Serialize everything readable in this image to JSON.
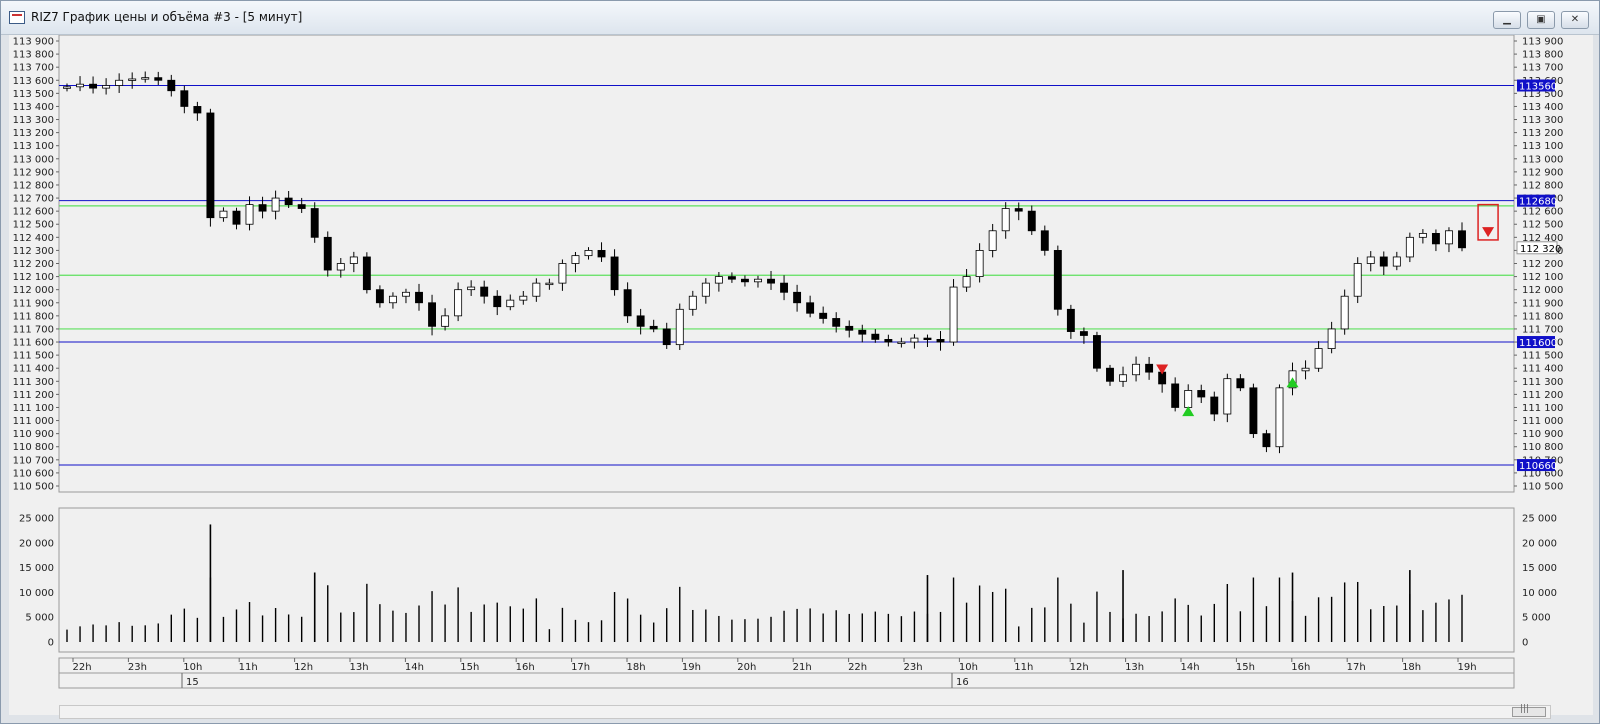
{
  "window": {
    "title": "RIZ7 График цены и объёма #3 - [5 минут]",
    "buttons": [
      "▁",
      "▣",
      "✕"
    ]
  },
  "chart_data": {
    "type": "candlestick",
    "price_axis": {
      "min": 110500,
      "max": 113900,
      "tick_step": 100,
      "tick_labels": [
        "113 900",
        "113 800",
        "113 700",
        "113 600",
        "113 500",
        "113 400",
        "113 300",
        "113 200",
        "113 100",
        "113 000",
        "112 900",
        "112 800",
        "112 700",
        "112 600",
        "112 500",
        "112 400",
        "112 300",
        "112 200",
        "112 100",
        "112 000",
        "111 900",
        "111 800",
        "111 700",
        "111 600",
        "111 500",
        "111 400",
        "111 300",
        "111 200",
        "111 100",
        "111 000",
        "110 900",
        "110 800",
        "110 700",
        "110 600",
        "110 500"
      ]
    },
    "volume_axis": {
      "min": 0,
      "max": 25000,
      "tick_labels": [
        "25 000",
        "20 000",
        "15 000",
        "10 000",
        "5 000",
        "0"
      ],
      "tick_values": [
        25000,
        20000,
        15000,
        10000,
        5000,
        0
      ]
    },
    "time_axis": {
      "hour_labels": [
        "22h",
        "23h",
        "10h",
        "11h",
        "12h",
        "13h",
        "14h",
        "15h",
        "16h",
        "17h",
        "18h",
        "19h",
        "20h",
        "21h",
        "22h",
        "23h",
        "10h",
        "11h",
        "12h",
        "13h",
        "14h",
        "15h",
        "16h",
        "17h",
        "18h",
        "19h"
      ],
      "date_labels": [
        "15",
        "16"
      ]
    },
    "blue_levels": [
      {
        "value": 113560,
        "label": "113560"
      },
      {
        "value": 112680,
        "label": "112680"
      },
      {
        "value": 111600,
        "label": "111600"
      },
      {
        "value": 110660,
        "label": "110660"
      }
    ],
    "green_levels": [
      112640,
      112110,
      111700
    ],
    "last_price": {
      "value": 112320,
      "label": "112 320"
    },
    "colors": {
      "level_blue": "#1010c8",
      "level_green": "#5ee05e",
      "candle": "#000000",
      "signal_buy": "#22cc22",
      "signal_sell": "#dd2222",
      "grid_border": "#9a9a9a"
    },
    "signals": [
      {
        "type": "sell",
        "time": "13:35",
        "price": 111390
      },
      {
        "type": "buy",
        "time": "14:05",
        "price": 111080
      },
      {
        "type": "buy",
        "time": "16:00",
        "price": 111300
      },
      {
        "type": "sell",
        "time": "19:10",
        "price": 112440
      }
    ],
    "close_series": [
      {
        "t": "21:25",
        "v": 113550
      },
      {
        "t": "21:40",
        "v": 113570
      },
      {
        "t": "21:55",
        "v": 113540
      },
      {
        "t": "22:10",
        "v": 113560
      },
      {
        "t": "22:25",
        "v": 113600
      },
      {
        "t": "22:40",
        "v": 113610
      },
      {
        "t": "22:55",
        "v": 113620
      },
      {
        "t": "23:10",
        "v": 113600
      },
      {
        "t": "23:25",
        "v": 113520
      },
      {
        "t": "23:40",
        "v": 113400
      },
      {
        "t": "23:50",
        "v": 113350
      },
      {
        "t": "10:00",
        "v": 112550
      },
      {
        "t": "10:15",
        "v": 112600
      },
      {
        "t": "10:30",
        "v": 112500
      },
      {
        "t": "10:45",
        "v": 112650
      },
      {
        "t": "11:00",
        "v": 112600
      },
      {
        "t": "11:15",
        "v": 112700
      },
      {
        "t": "11:30",
        "v": 112650
      },
      {
        "t": "11:45",
        "v": 112620
      },
      {
        "t": "12:00",
        "v": 112400
      },
      {
        "t": "12:15",
        "v": 112150
      },
      {
        "t": "12:30",
        "v": 112200
      },
      {
        "t": "12:45",
        "v": 112250
      },
      {
        "t": "13:00",
        "v": 112000
      },
      {
        "t": "13:15",
        "v": 111900
      },
      {
        "t": "13:30",
        "v": 111950
      },
      {
        "t": "13:45",
        "v": 111980
      },
      {
        "t": "14:00",
        "v": 111900
      },
      {
        "t": "14:10",
        "v": 111720
      },
      {
        "t": "14:25",
        "v": 111800
      },
      {
        "t": "14:40",
        "v": 112000
      },
      {
        "t": "14:55",
        "v": 112020
      },
      {
        "t": "15:10",
        "v": 111950
      },
      {
        "t": "15:25",
        "v": 111870
      },
      {
        "t": "15:40",
        "v": 111920
      },
      {
        "t": "15:55",
        "v": 111950
      },
      {
        "t": "16:10",
        "v": 112050
      },
      {
        "t": "16:25",
        "v": 112050
      },
      {
        "t": "16:40",
        "v": 112200
      },
      {
        "t": "16:55",
        "v": 112260
      },
      {
        "t": "17:10",
        "v": 112300
      },
      {
        "t": "17:25",
        "v": 112250
      },
      {
        "t": "17:35",
        "v": 112000
      },
      {
        "t": "17:50",
        "v": 111800
      },
      {
        "t": "18:05",
        "v": 111720
      },
      {
        "t": "18:20",
        "v": 111700
      },
      {
        "t": "18:30",
        "v": 111580
      },
      {
        "t": "18:45",
        "v": 111850
      },
      {
        "t": "19:00",
        "v": 111950
      },
      {
        "t": "19:15",
        "v": 112050
      },
      {
        "t": "19:30",
        "v": 112100
      },
      {
        "t": "19:45",
        "v": 112080
      },
      {
        "t": "20:00",
        "v": 112060
      },
      {
        "t": "20:15",
        "v": 112080
      },
      {
        "t": "20:30",
        "v": 112050
      },
      {
        "t": "20:45",
        "v": 111980
      },
      {
        "t": "21:00",
        "v": 111900
      },
      {
        "t": "21:15",
        "v": 111820
      },
      {
        "t": "21:30",
        "v": 111780
      },
      {
        "t": "21:45",
        "v": 111720
      },
      {
        "t": "22:00",
        "v": 111690
      },
      {
        "t": "22:15",
        "v": 111660
      },
      {
        "t": "22:30",
        "v": 111620
      },
      {
        "t": "22:45",
        "v": 111600
      },
      {
        "t": "23:00",
        "v": 111600
      },
      {
        "t": "23:15",
        "v": 111630
      },
      {
        "t": "23:30",
        "v": 111620
      },
      {
        "t": "23:45",
        "v": 111600
      },
      {
        "t": "10:00",
        "v": 112020
      },
      {
        "t": "10:15",
        "v": 112100
      },
      {
        "t": "10:30",
        "v": 112300
      },
      {
        "t": "10:45",
        "v": 112450
      },
      {
        "t": "11:00",
        "v": 112620
      },
      {
        "t": "11:15",
        "v": 112600
      },
      {
        "t": "11:30",
        "v": 112450
      },
      {
        "t": "11:45",
        "v": 112300
      },
      {
        "t": "12:00",
        "v": 111850
      },
      {
        "t": "12:15",
        "v": 111680
      },
      {
        "t": "12:30",
        "v": 111650
      },
      {
        "t": "12:45",
        "v": 111400
      },
      {
        "t": "13:00",
        "v": 111300
      },
      {
        "t": "13:15",
        "v": 111350
      },
      {
        "t": "13:30",
        "v": 111430
      },
      {
        "t": "13:45",
        "v": 111370
      },
      {
        "t": "14:00",
        "v": 111280
      },
      {
        "t": "14:10",
        "v": 111100
      },
      {
        "t": "14:25",
        "v": 111230
      },
      {
        "t": "14:40",
        "v": 111180
      },
      {
        "t": "14:55",
        "v": 111050
      },
      {
        "t": "15:10",
        "v": 111320
      },
      {
        "t": "15:25",
        "v": 111250
      },
      {
        "t": "15:40",
        "v": 110900
      },
      {
        "t": "15:55",
        "v": 110800
      },
      {
        "t": "16:05",
        "v": 111250
      },
      {
        "t": "16:20",
        "v": 111380
      },
      {
        "t": "16:35",
        "v": 111400
      },
      {
        "t": "16:50",
        "v": 111550
      },
      {
        "t": "17:05",
        "v": 111700
      },
      {
        "t": "17:20",
        "v": 111950
      },
      {
        "t": "17:35",
        "v": 112200
      },
      {
        "t": "17:50",
        "v": 112250
      },
      {
        "t": "18:05",
        "v": 112180
      },
      {
        "t": "18:20",
        "v": 112250
      },
      {
        "t": "18:35",
        "v": 112400
      },
      {
        "t": "18:50",
        "v": 112430
      },
      {
        "t": "19:05",
        "v": 112350
      },
      {
        "t": "19:15",
        "v": 112450
      },
      {
        "t": "19:20",
        "v": 112320
      }
    ],
    "volume_spikes": [
      {
        "t": "10:00",
        "v": 23700
      },
      {
        "t": "12:00",
        "v": 14000
      },
      {
        "t": "10:00",
        "v": 13500
      },
      {
        "t": "13:45",
        "v": 14500
      },
      {
        "t": "15:40",
        "v": 14000
      },
      {
        "t": "17:10",
        "v": 14500
      },
      {
        "t": "18:35",
        "v": 14500
      }
    ]
  }
}
